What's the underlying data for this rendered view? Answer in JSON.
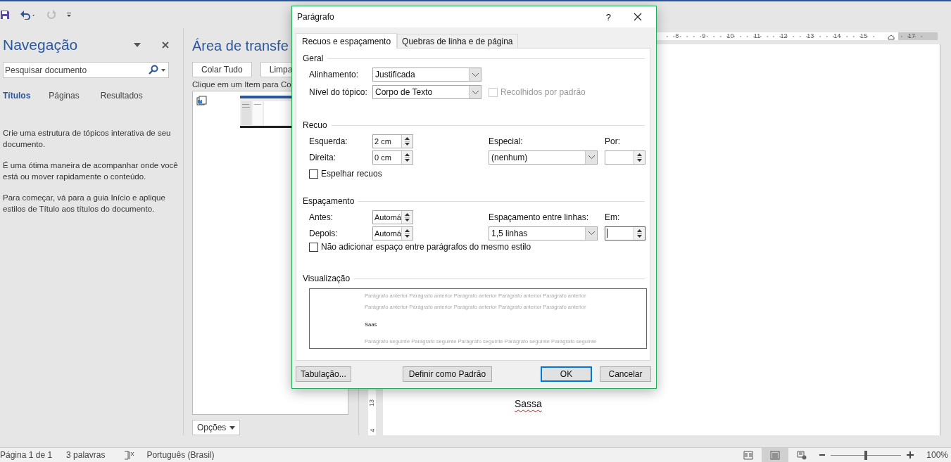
{
  "quick_access": {
    "undo_enabled": true,
    "redo_enabled": false
  },
  "navigation": {
    "title": "Navegação",
    "search": {
      "placeholder": "Pesquisar documento"
    },
    "tabs": [
      {
        "label": "Títulos",
        "selected": true
      },
      {
        "label": "Páginas",
        "selected": false
      },
      {
        "label": "Resultados",
        "selected": false
      }
    ],
    "paragraphs": [
      "Crie uma estrutura de tópicos interativa de seu documento.",
      "É uma ótima maneira de acompanhar onde você está ou mover rapidamente o conteúdo.",
      "Para começar, vá para a guia Início e aplique estilos de Título aos títulos do documento."
    ]
  },
  "clipboard": {
    "title": "Área de transfe",
    "buttons": [
      "Colar Tudo",
      "Limpa"
    ],
    "instruction": "Clique em um Item para Co",
    "items": [
      {
        "kind": "picture"
      }
    ],
    "options_button": "Opções"
  },
  "ruler": {
    "numbers_before_indent": [
      "8",
      "9",
      "10",
      "11",
      "12",
      "13",
      "14",
      "15"
    ],
    "numbers_after_indent": [
      "17"
    ]
  },
  "vertical_ruler": [
    "13",
    "4"
  ],
  "document": {
    "text": "Sassa",
    "spelling_error": true
  },
  "dialog": {
    "title": "Parágrafo",
    "help": "?",
    "tabs": [
      {
        "label": "Recuos e espaçamento",
        "selected": true
      },
      {
        "label": "Quebras de linha e de página",
        "selected": false
      }
    ],
    "general": {
      "heading": "Geral",
      "alignment": {
        "label": "Alinhamento:",
        "value": "Justificada"
      },
      "outline_level": {
        "label": "Nível do tópico:",
        "value": "Corpo de Texto"
      },
      "collapsed": {
        "label": "Recolhidos por padrão",
        "checked": false,
        "disabled": true
      }
    },
    "indent": {
      "heading": "Recuo",
      "left": {
        "label": "Esquerda:",
        "value": "2 cm"
      },
      "right": {
        "label": "Direita:",
        "value": "0 cm"
      },
      "special": {
        "label": "Especial:",
        "value": "(nenhum)"
      },
      "by": {
        "label": "Por:"
      },
      "mirror": {
        "label": "Espelhar recuos",
        "checked": false
      }
    },
    "spacing": {
      "heading": "Espaçamento",
      "before": {
        "label": "Antes:",
        "value": "Automá"
      },
      "after": {
        "label": "Depois:",
        "value": "Automá"
      },
      "line_spacing": {
        "label": "Espaçamento entre linhas:",
        "value": "1,5 linhas"
      },
      "at": {
        "label": "Em:",
        "focused": true
      },
      "no_space": {
        "label": "Não adicionar espaço entre parágrafos do mesmo estilo",
        "checked": false
      }
    },
    "preview": {
      "heading": "Visualização",
      "previous": [
        "Parágrafo anterior Parágrafo anterior Parágrafo anterior Parágrafo anterior Parágrafo anterior",
        "Parágrafo anterior Parágrafo anterior Parágrafo anterior Parágrafo anterior Parágrafo anterior"
      ],
      "current": "Saas",
      "next": "Parágrafo seguinte Parágrafo seguinte Parágrafo seguinte Parágrafo seguinte Parágrafo seguinte"
    },
    "buttons": [
      {
        "label": "Tabulação...",
        "default": false
      },
      {
        "label": "Definir como Padrão",
        "default": false
      },
      {
        "label": "OK",
        "default": true
      },
      {
        "label": "Cancelar",
        "default": false
      }
    ]
  },
  "status_bar": {
    "page": "Página 1 de 1",
    "words": "3 palavras",
    "language": "Português (Brasil)",
    "views": [
      {
        "kind": "read",
        "selected": false
      },
      {
        "kind": "print",
        "selected": true
      },
      {
        "kind": "web",
        "selected": false
      }
    ],
    "zoom": {
      "level": 0.5,
      "reading": "100%"
    }
  }
}
